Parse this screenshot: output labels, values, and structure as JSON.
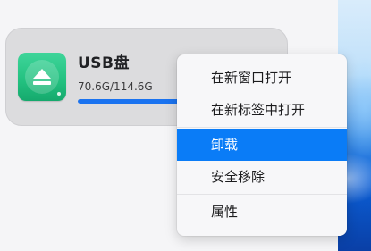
{
  "drive": {
    "name": "USB盘",
    "usage_text": "70.6G/114.6G",
    "used_fraction": 0.616,
    "icon": "usb-eject-icon",
    "accent_color": "#1a73f0",
    "icon_color": "#22c07f"
  },
  "context_menu": {
    "items": [
      {
        "label": "在新窗口打开",
        "highlighted": false
      },
      {
        "label": "在新标签中打开",
        "highlighted": false
      },
      {
        "label": "卸载",
        "highlighted": true
      },
      {
        "label": "安全移除",
        "highlighted": false
      },
      {
        "label": "属性",
        "highlighted": false
      }
    ],
    "highlight_color": "#0a7cf7"
  }
}
